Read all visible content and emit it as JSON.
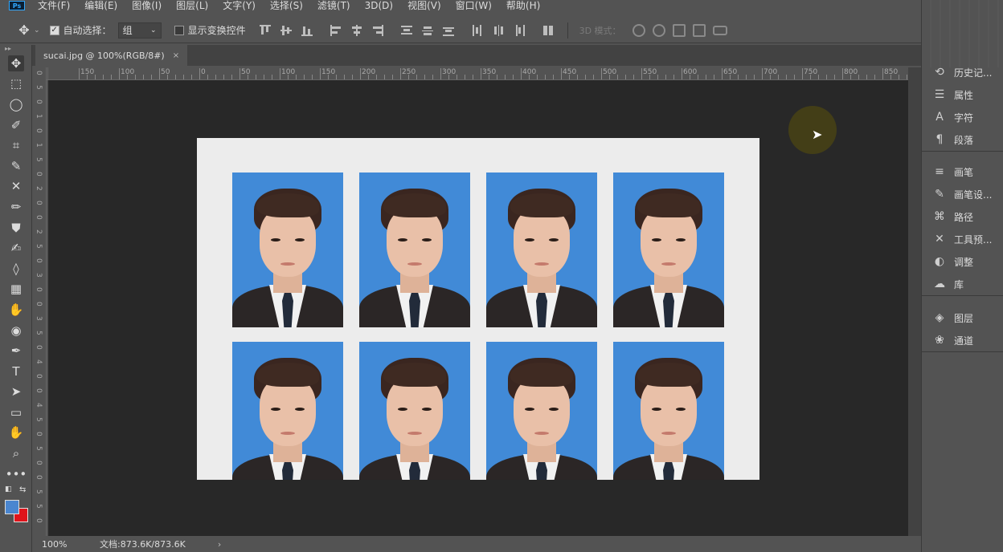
{
  "menu": [
    "文件(F)",
    "编辑(E)",
    "图像(I)",
    "图层(L)",
    "文字(Y)",
    "选择(S)",
    "滤镜(T)",
    "3D(D)",
    "视图(V)",
    "窗口(W)",
    "帮助(H)"
  ],
  "app_logo": "Ps",
  "options": {
    "auto_select_label": "自动选择：",
    "auto_select_checked": true,
    "auto_select_target": "组",
    "show_transform_label": "显示变换控件",
    "show_transform_checked": false,
    "mode_3d_label": "3D 模式："
  },
  "document_tab": {
    "title": "sucai.jpg @ 100%(RGB/8#)",
    "close": "×"
  },
  "ruler_top": [
    "150",
    "100",
    "50",
    "0",
    "50",
    "100",
    "150",
    "200",
    "250",
    "300",
    "350",
    "400",
    "450",
    "500",
    "550",
    "600",
    "650",
    "700",
    "750",
    "800",
    "850"
  ],
  "ruler_left": [
    "0",
    "5",
    "0",
    "1",
    "0",
    "1",
    "5",
    "0",
    "2",
    "0",
    "0",
    "2",
    "5",
    "0",
    "3",
    "0",
    "0",
    "3",
    "5",
    "0",
    "4",
    "0",
    "0",
    "4",
    "5",
    "0",
    "5",
    "0",
    "0",
    "5",
    "5",
    "0"
  ],
  "tools": [
    "✥",
    "⬚",
    "◯",
    "✐",
    "⌗",
    "✎",
    "✕",
    "✏",
    "⛊",
    "✍",
    "◊",
    "▦",
    "✋",
    "◉",
    "✒",
    "T",
    "➤",
    "▭",
    "✋",
    "⌕",
    "•••"
  ],
  "colors": {
    "foreground": "#4a86d0",
    "background": "#e0141b",
    "photo_bg": "#418ad7"
  },
  "status": {
    "zoom": "100%",
    "doc_info": "文档:873.6K/873.6K",
    "arrow": "›"
  },
  "panels": {
    "group1": [
      {
        "icon": "history-icon",
        "glyph": "⟲",
        "label": "历史记..."
      },
      {
        "icon": "properties-icon",
        "glyph": "☰",
        "label": "属性"
      },
      {
        "icon": "character-icon",
        "glyph": "A",
        "label": "字符"
      },
      {
        "icon": "paragraph-icon",
        "glyph": "¶",
        "label": "段落"
      }
    ],
    "group2": [
      {
        "icon": "brush-settings-icon",
        "glyph": "≡",
        "label": "画笔"
      },
      {
        "icon": "brush-presets-icon",
        "glyph": "✎",
        "label": "画笔设..."
      },
      {
        "icon": "paths-icon",
        "glyph": "⌘",
        "label": "路径"
      },
      {
        "icon": "tool-presets-icon",
        "glyph": "✕",
        "label": "工具预..."
      },
      {
        "icon": "adjustments-icon",
        "glyph": "◐",
        "label": "调整"
      },
      {
        "icon": "libraries-icon",
        "glyph": "☁",
        "label": "库"
      }
    ],
    "group3": [
      {
        "icon": "layers-icon",
        "glyph": "◈",
        "label": "图层"
      },
      {
        "icon": "channels-icon",
        "glyph": "❀",
        "label": "通道"
      }
    ]
  }
}
